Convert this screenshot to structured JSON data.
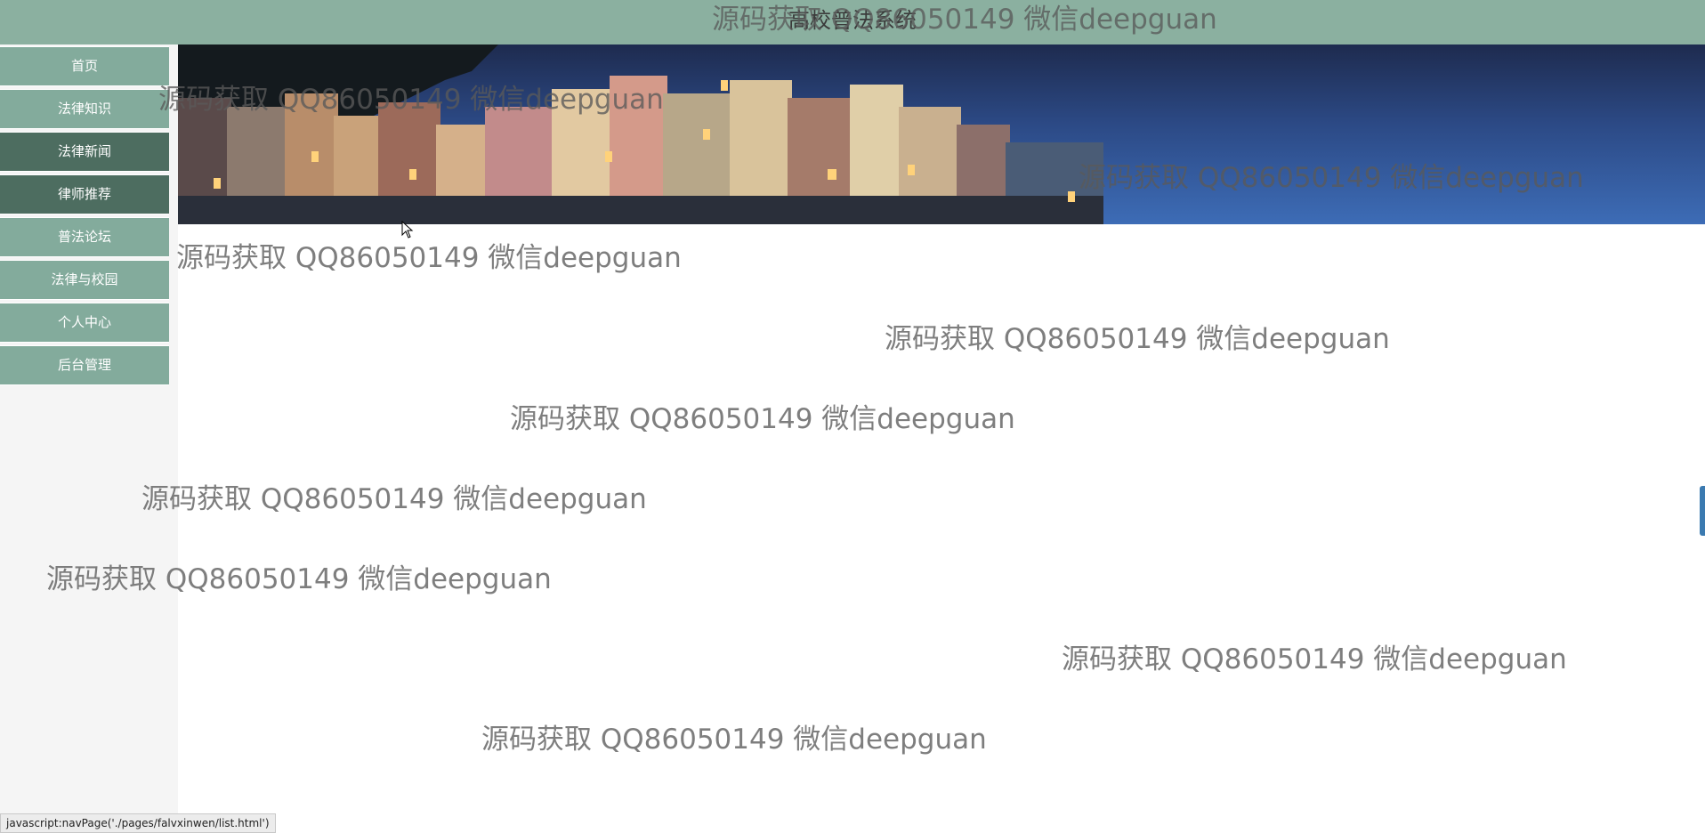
{
  "header": {
    "title": "高校普法系统"
  },
  "sidebar": {
    "items": [
      {
        "label": "首页"
      },
      {
        "label": "法律知识"
      },
      {
        "label": "法律新闻"
      },
      {
        "label": "律师推荐"
      },
      {
        "label": "普法论坛"
      },
      {
        "label": "法律与校园"
      },
      {
        "label": "个人中心"
      },
      {
        "label": "后台管理"
      }
    ]
  },
  "watermark": {
    "text": "源码获取 QQ86050149 微信deepguan"
  },
  "statusbar": {
    "url": "javascript:navPage('./pages/falvxinwen/list.html')"
  },
  "colors": {
    "topbar": "#8bb0a0",
    "nav_item": "#83ab9c",
    "nav_active": "#4d6d60"
  }
}
